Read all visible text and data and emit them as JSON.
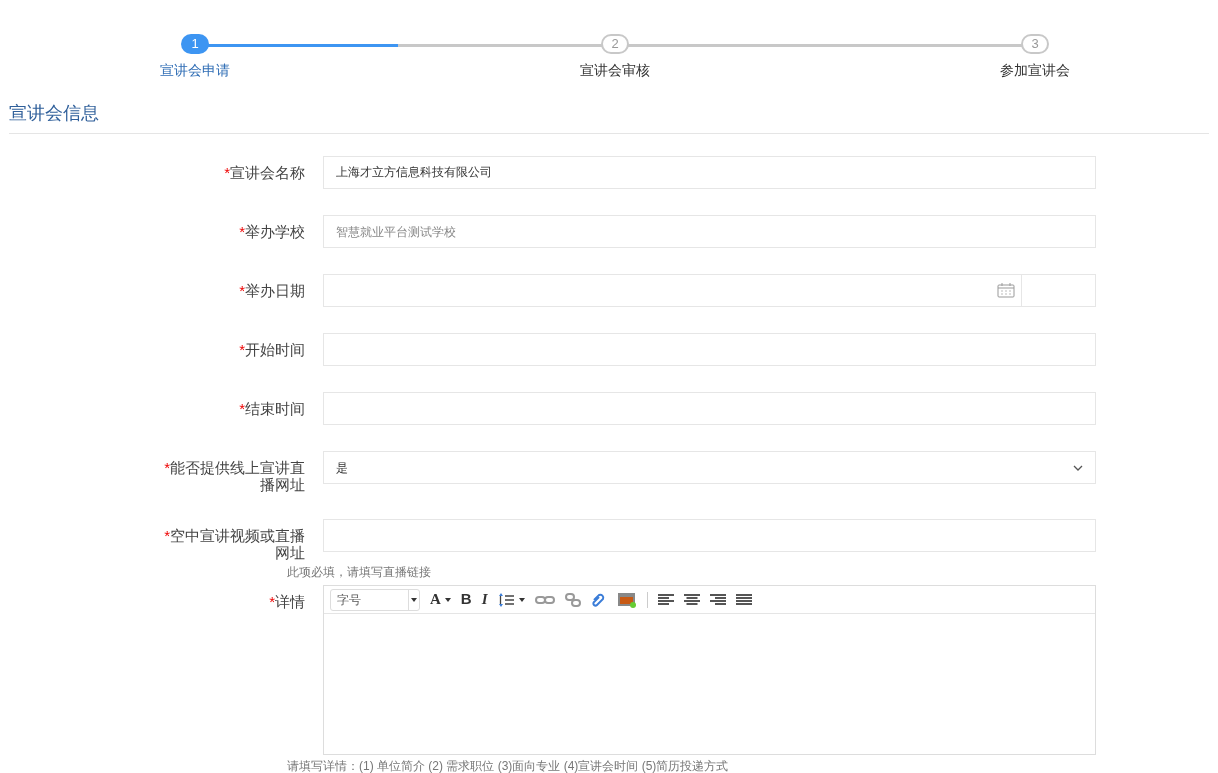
{
  "steps": [
    {
      "number": "1",
      "label": "宣讲会申请",
      "selected": true
    },
    {
      "number": "2",
      "label": "宣讲会审核",
      "selected": false
    },
    {
      "number": "3",
      "label": "参加宣讲会",
      "selected": false
    }
  ],
  "progress": {
    "level": 0.235
  },
  "section_title": "宣讲会信息",
  "required_mark": "*",
  "fields": [
    {
      "kind": "text",
      "label": "宣讲会名称",
      "value": "上海才立方信息科技有限公司"
    },
    {
      "kind": "text",
      "label": "举办学校",
      "placeholder": "智慧就业平台测试学校"
    },
    {
      "kind": "date",
      "label": "举办日期"
    },
    {
      "kind": "text",
      "label": "开始时间"
    },
    {
      "kind": "text",
      "label": "结束时间"
    },
    {
      "kind": "select",
      "label": "能否提供线上宣讲直播网址",
      "value": "是"
    },
    {
      "kind": "text",
      "label": "空中宣讲视频或直播网址",
      "hint": "此项必填，请填写直播链接"
    },
    {
      "kind": "editor",
      "label": "详情",
      "hint": "请填写详情：(1) 单位简介 (2) 需求职位 (3)面向专业 (4)宣讲会时间 (5)简历投递方式"
    }
  ],
  "toolbar": {
    "font_size": "字号",
    "glyphs": [
      {
        "kind": "font-color",
        "label": "A"
      },
      {
        "kind": "bold",
        "label": "B"
      },
      {
        "kind": "italic",
        "label": "I"
      }
    ]
  }
}
